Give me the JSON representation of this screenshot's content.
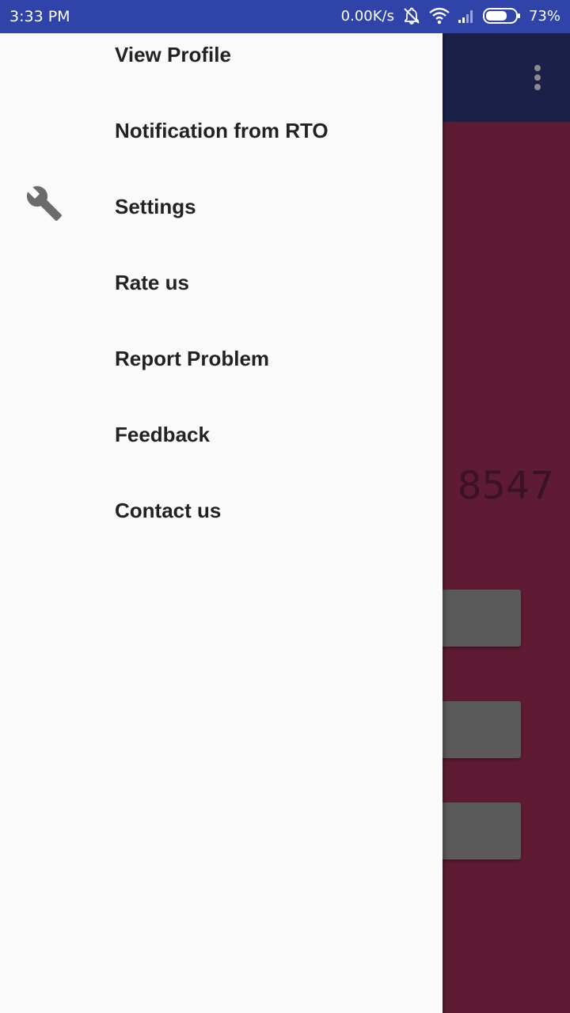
{
  "status_bar": {
    "time": "3:33 PM",
    "net_speed": "0.00K/s",
    "battery_percent": "73%",
    "icons": [
      "notifications-off-icon",
      "wifi-icon",
      "signal-icon",
      "battery-icon"
    ],
    "battery_level": 0.73
  },
  "drawer": {
    "items": [
      {
        "label": "View Profile",
        "icon": null
      },
      {
        "label": "Notification from RTO",
        "icon": null
      },
      {
        "label": "Settings",
        "icon": "wrench-icon"
      },
      {
        "label": "Rate us",
        "icon": null
      },
      {
        "label": "Report Problem",
        "icon": null
      },
      {
        "label": "Feedback",
        "icon": null
      },
      {
        "label": "Contact us",
        "icon": null
      }
    ]
  },
  "background": {
    "number_fragment": "8547",
    "overflow_icon": "overflow-menu-icon"
  },
  "colors": {
    "status_bar": "#2f43a8",
    "toolbar": "#1b2049",
    "screen_background": "#5f1b33",
    "drawer_background": "#fafafa",
    "button_grey": "#5a5a5a"
  }
}
